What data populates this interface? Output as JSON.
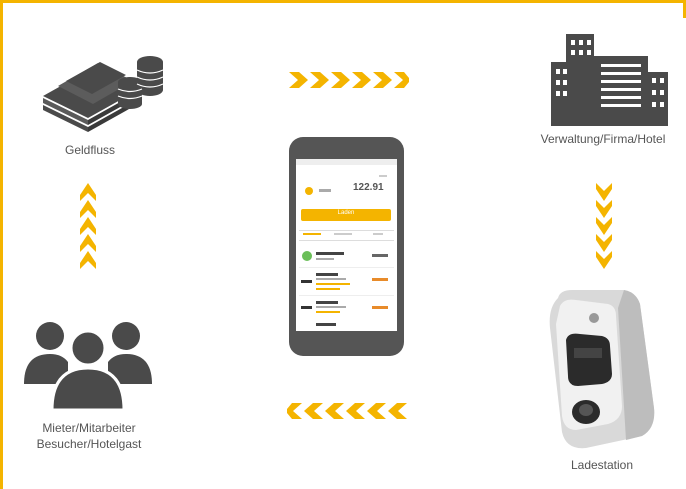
{
  "nodes": {
    "money": {
      "label": "Geldfluss"
    },
    "company": {
      "label": "Verwaltung/Firma/Hotel"
    },
    "users": {
      "label_line1": "Mieter/Mitarbeiter",
      "label_line2": "Besucher/Hotelgast"
    },
    "charger": {
      "label": "Ladestation"
    }
  },
  "phone": {
    "balance": "122.91",
    "button_label": "Laden"
  },
  "colors": {
    "accent": "#f4b400",
    "icon": "#4a4a4a",
    "label": "#555555"
  },
  "icons": {
    "money": "money-stack-icon",
    "company": "office-building-icon",
    "users": "people-group-icon",
    "charger": "charging-station-icon"
  }
}
